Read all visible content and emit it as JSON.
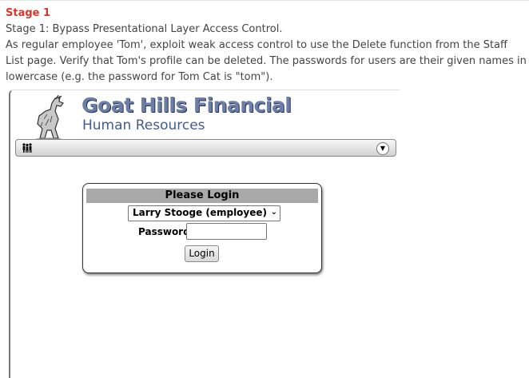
{
  "lesson": {
    "stage_title": "Stage 1",
    "instructions": [
      "Stage 1: Bypass Presentational Layer Access Control.",
      "As regular employee 'Tom', exploit weak access control to use the Delete function from the Staff List page. Verify that Tom's profile can be deleted. The passwords for users are their given names in lowercase (e.g. the password for Tom Cat is \"tom\")."
    ]
  },
  "app": {
    "brand_title": "Goat Hills Financial",
    "brand_subtitle": "Human Resources"
  },
  "menu": {
    "icons": [
      "people-icon",
      "dropdown-arrow-icon"
    ]
  },
  "login": {
    "header": "Please Login",
    "selected_employee": "Larry Stooge (employee)",
    "password_label": "Password",
    "password_value": "",
    "button_label": "Login"
  }
}
